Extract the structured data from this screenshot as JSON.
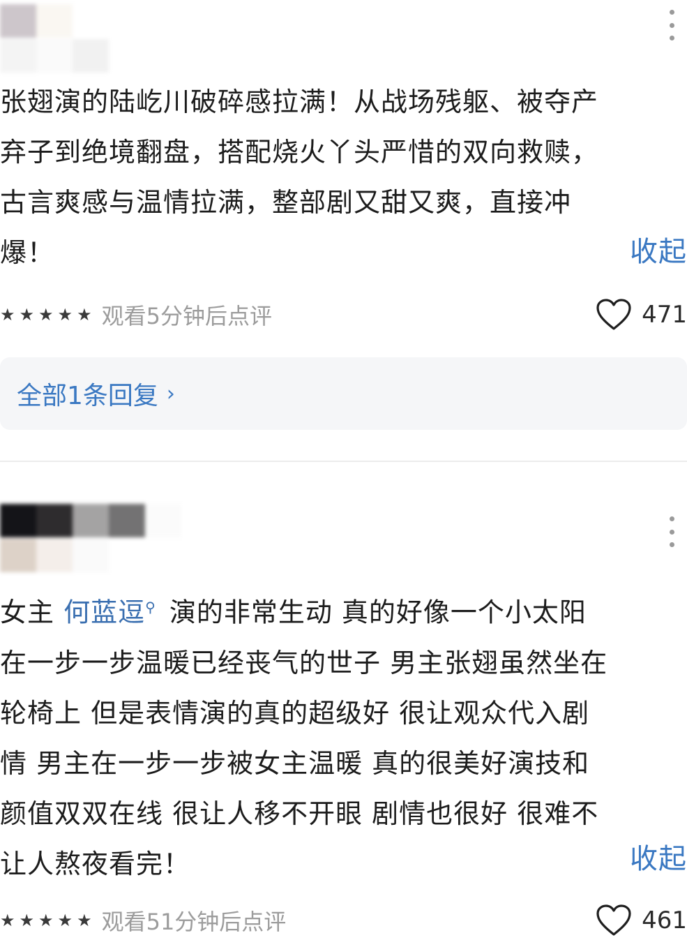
{
  "comments": [
    {
      "lines": [
        "张翅演的陆屹川破碎感拉满！从战场残躯、被夺产",
        "弃子到绝境翻盘，搭配烧火丫头严惜的双向救赎，",
        "古言爽感与温情拉满，整部剧又甜又爽，直接冲",
        "爆！"
      ],
      "collapse_label": "收起",
      "rating_stars": 5,
      "meta": "观看5分钟后点评",
      "like_count": "471",
      "reply_label": "全部1条回复",
      "reply_chevron": "›"
    },
    {
      "line1_prefix": "女主 ",
      "mention": "何蓝逗",
      "line1_suffix": " 演的非常生动 真的好像一个小太阳",
      "lines": [
        "在一步一步温暖已经丧气的世子 男主张翅虽然坐在",
        "轮椅上 但是表情演的真的超级好 很让观众代入剧",
        "情 男主在一步一步被女主温暖 真的很美好演技和",
        "颜值双双在线 很让人移不开眼 剧情也很好 很难不",
        "让人熬夜看完！"
      ],
      "collapse_label": "收起",
      "rating_stars": 5,
      "meta": "观看51分钟后点评",
      "like_count": "461"
    }
  ],
  "colors": {
    "link": "#3a78c2",
    "meta": "#9c9c9c",
    "reply_bg": "#f5f6f8"
  },
  "icons": {
    "star": "star-icon",
    "heart": "heart-outline-icon",
    "more": "more-vertical-icon",
    "mention": "search-magnifier-icon",
    "chevron": "chevron-right-icon"
  }
}
